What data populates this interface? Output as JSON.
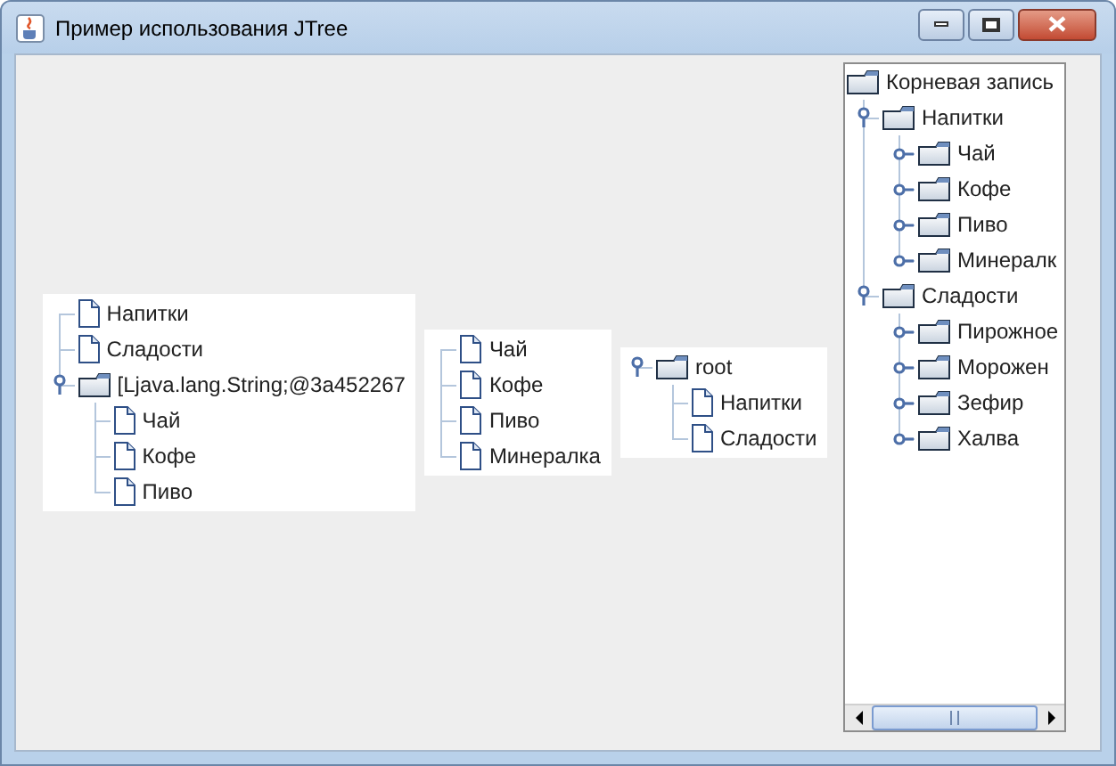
{
  "window": {
    "title": "Пример использования JTree"
  },
  "trees": [
    {
      "root_handles": true,
      "nodes": [
        {
          "label": "Напитки",
          "kind": "leaf"
        },
        {
          "label": "Сладости",
          "kind": "leaf"
        },
        {
          "label": "[Ljava.lang.String;@3a452267",
          "kind": "folder",
          "expanded": true,
          "children": [
            {
              "label": "Чай",
              "kind": "leaf"
            },
            {
              "label": "Кофе",
              "kind": "leaf"
            },
            {
              "label": "Пиво",
              "kind": "leaf"
            }
          ]
        }
      ]
    },
    {
      "root_handles": true,
      "nodes": [
        {
          "label": "Чай",
          "kind": "leaf"
        },
        {
          "label": "Кофе",
          "kind": "leaf"
        },
        {
          "label": "Пиво",
          "kind": "leaf"
        },
        {
          "label": "Минералка",
          "kind": "leaf"
        }
      ]
    },
    {
      "root_handles": true,
      "nodes": [
        {
          "label": "root",
          "kind": "folder",
          "expanded": true,
          "children": [
            {
              "label": "Напитки",
              "kind": "leaf"
            },
            {
              "label": "Сладости",
              "kind": "leaf"
            }
          ]
        }
      ]
    },
    {
      "root_handles": false,
      "scroll": true,
      "nodes": [
        {
          "label": "Корневая запись",
          "kind": "folder",
          "children": [
            {
              "label": "Напитки",
              "kind": "folder",
              "expanded": true,
              "children": [
                {
                  "label": "Чай",
                  "kind": "folder",
                  "expanded": false
                },
                {
                  "label": "Кофе",
                  "kind": "folder",
                  "expanded": false
                },
                {
                  "label": "Пиво",
                  "kind": "folder",
                  "expanded": false
                },
                {
                  "label": "Минералк",
                  "kind": "folder",
                  "expanded": false
                }
              ]
            },
            {
              "label": "Сладости",
              "kind": "folder",
              "expanded": true,
              "children": [
                {
                  "label": "Пирожное",
                  "kind": "folder",
                  "expanded": false
                },
                {
                  "label": "Морожен",
                  "kind": "folder",
                  "expanded": false
                },
                {
                  "label": "Зефир",
                  "kind": "folder",
                  "expanded": false
                },
                {
                  "label": "Халва",
                  "kind": "folder",
                  "expanded": false
                }
              ]
            }
          ]
        }
      ]
    }
  ]
}
